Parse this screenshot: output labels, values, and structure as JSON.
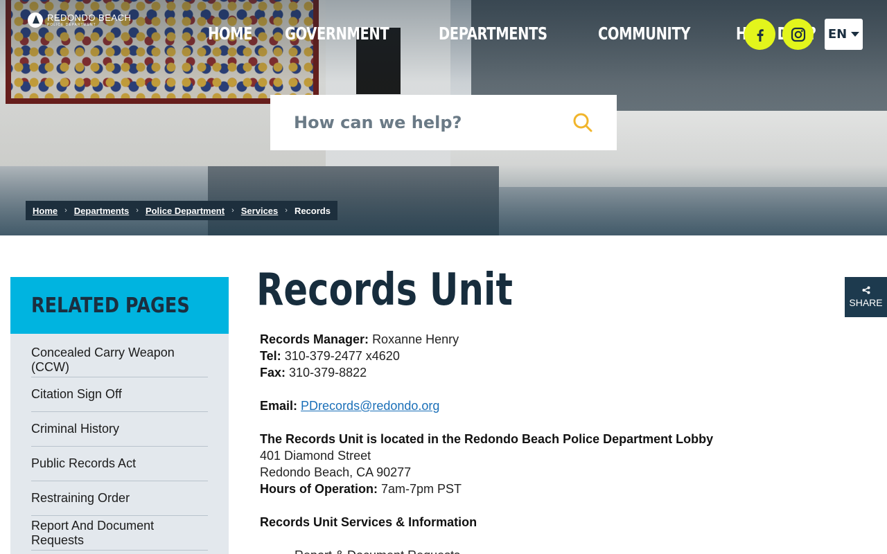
{
  "logo": {
    "line1": "REDONDO BEACH",
    "line2": "POLICE DEPARTMENT"
  },
  "nav": {
    "home": "HOME",
    "government": "GOVERNMENT",
    "departments": "DEPARTMENTS",
    "community": "COMMUNITY",
    "how": "HOW DO I?"
  },
  "language": "EN",
  "search": {
    "placeholder": "How can we help?"
  },
  "breadcrumb": {
    "home": "Home",
    "departments": "Departments",
    "police": "Police Department",
    "services": "Services",
    "current": "Records"
  },
  "sidebar": {
    "title": "RELATED PAGES",
    "items": [
      "Concealed Carry Weapon (CCW)",
      "Citation Sign Off",
      "Criminal History",
      "Public Records Act",
      "Restraining Order",
      "Report And Document Requests"
    ]
  },
  "page": {
    "title": "Records Unit",
    "manager_label": "Records Manager:",
    "manager": "Roxanne Henry",
    "tel_label": "Tel:",
    "tel": "310-379-2477 x4620",
    "fax_label": "Fax:",
    "fax": "310-379-8822",
    "email_label": "Email:",
    "email": "PDrecords@redondo.org",
    "location_heading": "The Records Unit is located in the Redondo Beach Police Department Lobby",
    "street": "401 Diamond Street",
    "city": "Redondo Beach, CA 90277",
    "hours_label": "Hours of Operation:",
    "hours": "7am-7pm PST",
    "services_heading": "Records Unit Services & Information",
    "services": [
      "Report & Document Requests"
    ]
  },
  "share": {
    "label": "SHARE"
  },
  "colors": {
    "accent_yellow": "#e3f51c",
    "accent_cyan": "#00b4e0",
    "navy": "#172d3d",
    "link": "#1a6fb8"
  }
}
